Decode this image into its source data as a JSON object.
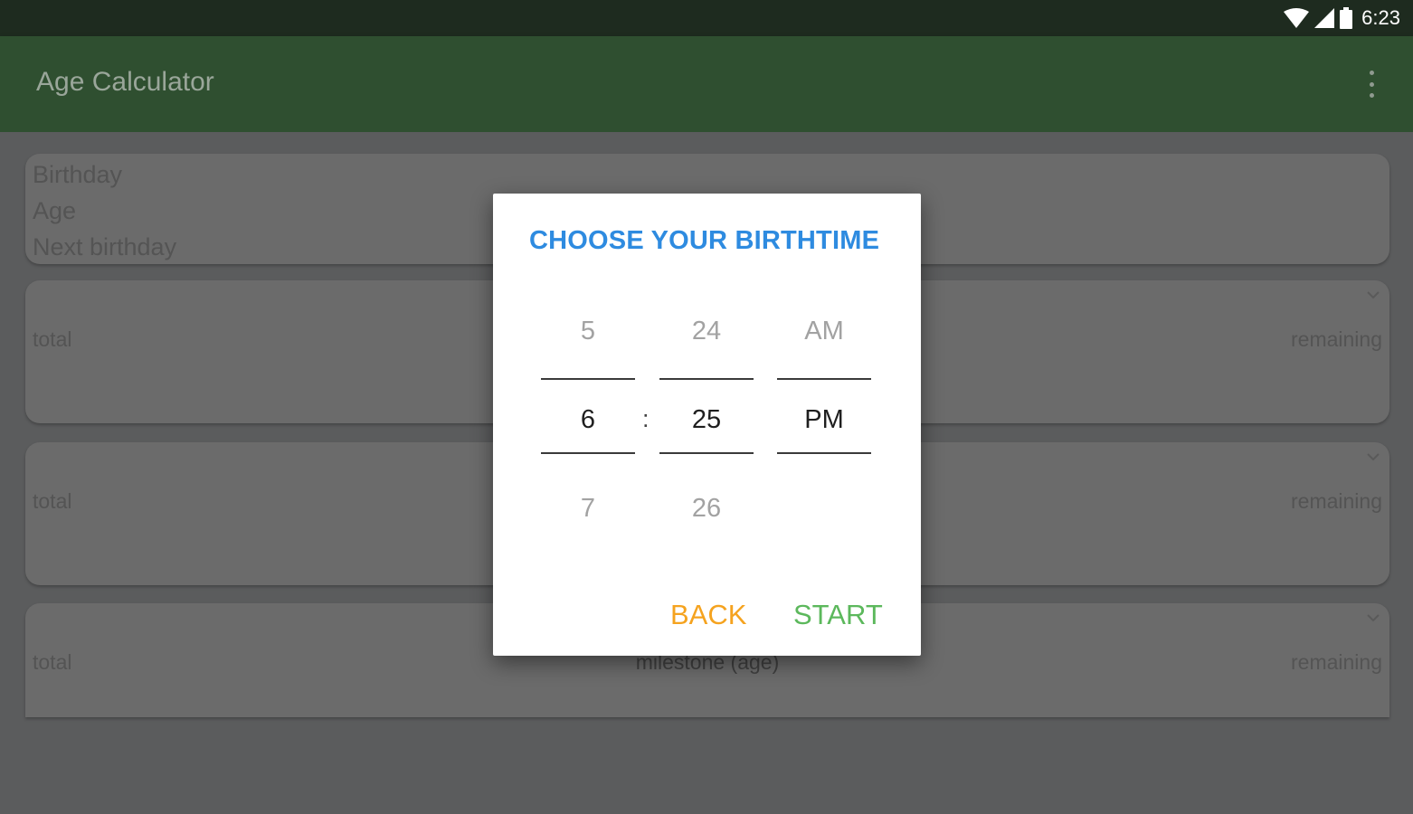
{
  "status_bar": {
    "time": "6:23"
  },
  "app_bar": {
    "title": "Age Calculator"
  },
  "info_card": {
    "lines": [
      "Birthday",
      "Age",
      "Next birthday"
    ]
  },
  "stat_cards": [
    {
      "left": "total",
      "right": "remaining",
      "center": ""
    },
    {
      "left": "total",
      "right": "remaining",
      "center": ""
    },
    {
      "left": "total",
      "right": "remaining",
      "center": "milestone (age)"
    }
  ],
  "dialog": {
    "title": "CHOOSE YOUR BIRTHTIME",
    "hour": {
      "prev": "5",
      "current": "6",
      "next": "7"
    },
    "minute": {
      "prev": "24",
      "current": "25",
      "next": "26"
    },
    "ampm": {
      "prev": "AM",
      "current": "PM",
      "next": ""
    },
    "separator": ":",
    "back_label": "BACK",
    "start_label": "START"
  },
  "colors": {
    "app_bar": "#2f4f30",
    "status_bar": "#1e2b1f",
    "title_accent": "#2e8be0",
    "back_button": "#f5a31f",
    "start_button": "#5cb85c"
  }
}
